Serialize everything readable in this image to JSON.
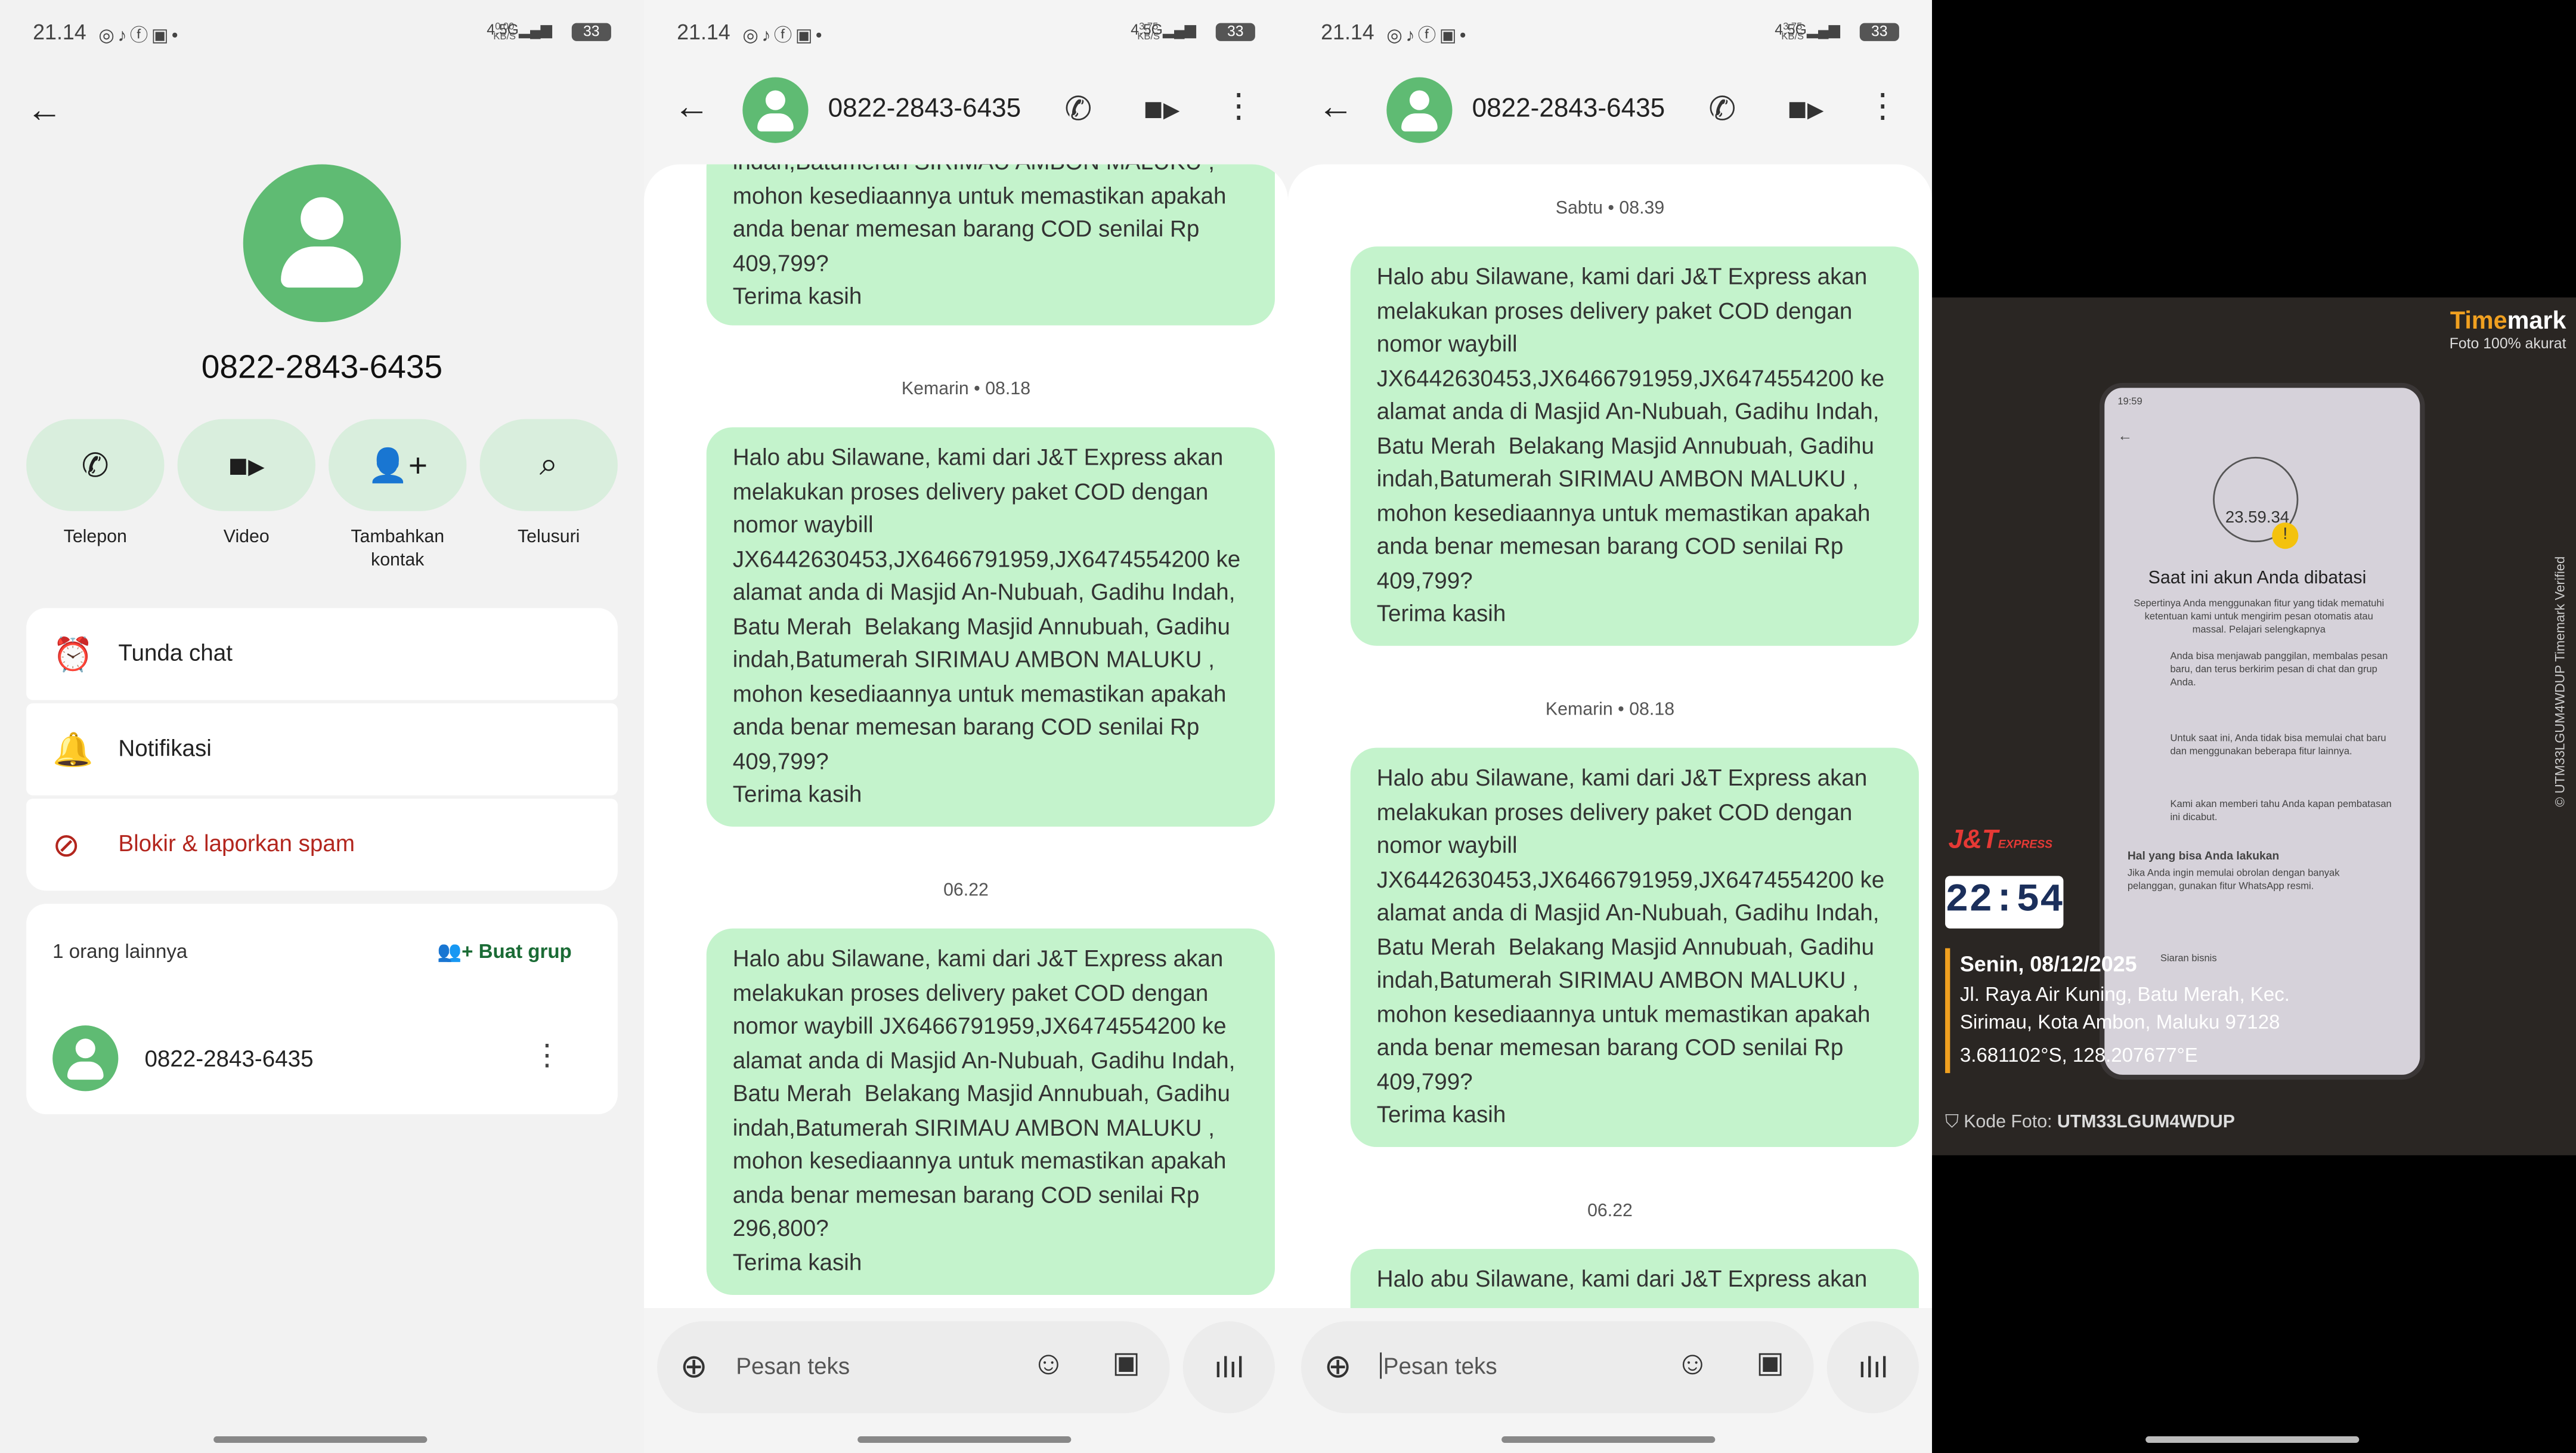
{
  "status_bar": {
    "p1": {
      "time": "21.14",
      "net_speed": "0,00",
      "net_unit": "KB/S",
      "signal": "4.5G",
      "battery": "33"
    },
    "p2": {
      "time": "21.14",
      "net_speed": "3,75",
      "net_unit": "KB/S",
      "signal": "4.5G",
      "battery": "33"
    },
    "p3": {
      "time": "21.14",
      "net_speed": "3,75",
      "net_unit": "KB/S",
      "signal": "4.5G",
      "battery": "33"
    }
  },
  "contact": {
    "number": "0822-2843-6435",
    "actions": [
      "Telepon",
      "Video",
      "Tambahkan kontak",
      "Telusuri"
    ],
    "settings": [
      "Tunda chat",
      "Notifikasi",
      "Blokir & laporkan spam"
    ],
    "others_label": "1 orang lainnya",
    "create_group": "Buat grup",
    "member": "0822-2843-6435"
  },
  "chat_p2": {
    "name": "0822-2843-6435",
    "partial": "indah,Batumerah SIRIMAU AMBON MALUKU ,\nmohon kesediaannya untuk memastikan apakah anda benar memesan barang COD senilai Rp 409,799?\nTerima kasih",
    "sep1": "Kemarin • 08.18",
    "msg1": "Halo abu Silawane, kami dari J&T Express akan melakukan proses delivery paket COD dengan nomor waybill JX6442630453,JX6466791959,JX6474554200 ke alamat anda di Masjid An-Nubuah, Gadihu Indah, Batu Merah  Belakang Masjid Annubuah, Gadihu indah,Batumerah SIRIMAU AMBON MALUKU ,\nmohon kesediaannya untuk memastikan apakah anda benar memesan barang COD senilai Rp 409,799?\nTerima kasih",
    "sep2": "06.22",
    "msg2": "Halo abu Silawane, kami dari J&T Express akan melakukan proses delivery paket COD dengan nomor waybill JX6466791959,JX6474554200 ke alamat anda di Masjid An-Nubuah, Gadihu Indah, Batu Merah  Belakang Masjid Annubuah, Gadihu indah,Batumerah SIRIMAU AMBON MALUKU ,\nmohon kesediaannya untuk memastikan apakah anda benar memesan barang COD senilai Rp 296,800?\nTerima kasih",
    "placeholder": "Pesan teks"
  },
  "chat_p3": {
    "name": "0822-2843-6435",
    "sep0": "Sabtu • 08.39",
    "msg0": "Halo abu Silawane, kami dari J&T Express akan melakukan proses delivery paket COD dengan nomor waybill JX6442630453,JX6466791959,JX6474554200 ke alamat anda di Masjid An-Nubuah, Gadihu Indah, Batu Merah  Belakang Masjid Annubuah, Gadihu indah,Batumerah SIRIMAU AMBON MALUKU ,\nmohon kesediaannya untuk memastikan apakah anda benar memesan barang COD senilai Rp 409,799?\nTerima kasih",
    "sep1": "Kemarin • 08.18",
    "msg1": "Halo abu Silawane, kami dari J&T Express akan melakukan proses delivery paket COD dengan nomor waybill JX6442630453,JX6466791959,JX6474554200 ke alamat anda di Masjid An-Nubuah, Gadihu Indah, Batu Merah  Belakang Masjid Annubuah, Gadihu indah,Batumerah SIRIMAU AMBON MALUKU ,\nmohon kesediaannya untuk memastikan apakah anda benar memesan barang COD senilai Rp 409,799?\nTerima kasih",
    "sep2": "06.22",
    "msg2": "Halo abu Silawane, kami dari J&T Express akan",
    "placeholder": "Pesan teks"
  },
  "photo": {
    "brand_a": "Time",
    "brand_b": "mark",
    "brand_sub": "Foto 100% akurat",
    "side_text": "© UTM33LGUM4WDUP   Timemark Verified",
    "logo": "J&T",
    "logo_sub": "EXPRESS",
    "clock": "22:54",
    "date": "Senin, 08/12/2025",
    "address": "Jl. Raya Air Kuning, Batu Merah, Kec. Sirimau, Kota Ambon, Maluku 97128",
    "coords": "3.681102°S, 128.207677°E",
    "code_label": "Kode Foto: ",
    "code": "UTM33LGUM4WDUP",
    "screen": {
      "time": "19:59",
      "countdown": "23.59.34",
      "heading": "Saat ini akun Anda dibatasi",
      "intro": "Sepertinya Anda menggunakan fitur yang tidak mematuhi ketentuan kami untuk mengirim pesan otomatis atau massal. Pelajari selengkapnya",
      "items": [
        "Anda bisa menjawab panggilan, membalas pesan baru, dan terus berkirim pesan di chat dan grup Anda.",
        "Untuk saat ini, Anda tidak bisa memulai chat baru dan menggunakan beberapa fitur lainnya.",
        "Kami akan memberi tahu Anda kapan pembatasan ini dicabut."
      ],
      "sub": "Hal yang bisa Anda lakukan",
      "sub_text": "Jika Anda ingin memulai obrolan dengan banyak pelanggan, gunakan fitur WhatsApp resmi.",
      "footer": "Siaran bisnis"
    }
  },
  "colors": {
    "accent": "#5fbb73",
    "bubble": "#c4f3cc",
    "danger": "#b3261e"
  }
}
